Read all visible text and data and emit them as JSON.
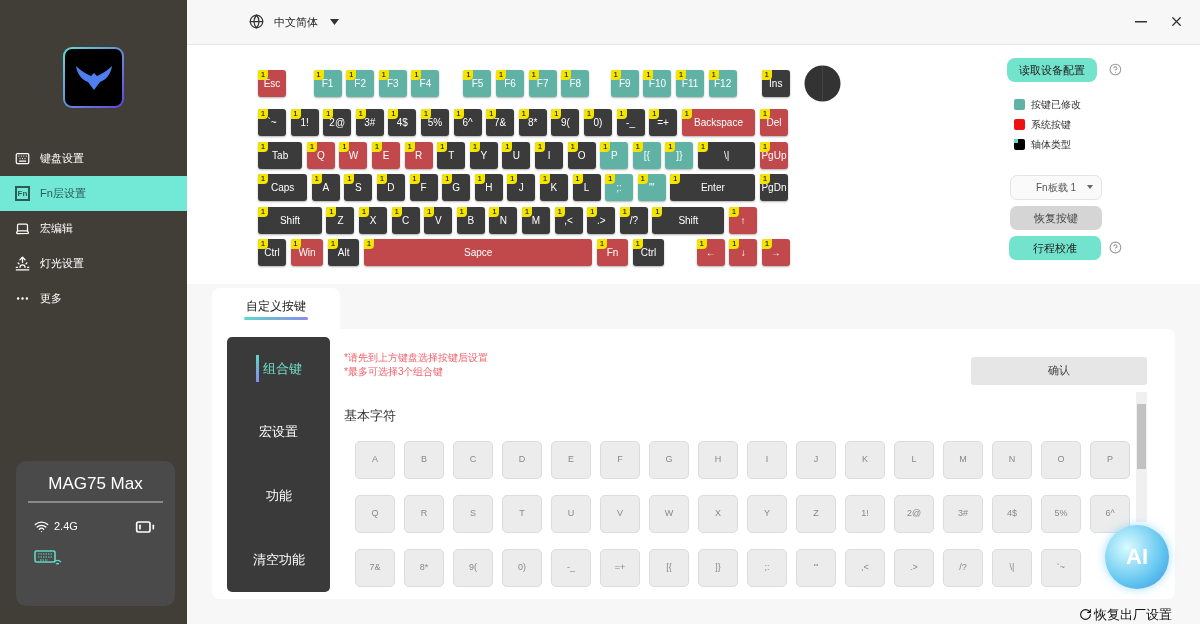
{
  "header": {
    "language": "中文简体"
  },
  "sidebar": {
    "items": [
      {
        "label": "键盘设置",
        "selected": false
      },
      {
        "label": "Fn层设置",
        "icon_text": "Fn",
        "selected": true
      },
      {
        "label": "宏编辑",
        "selected": false
      },
      {
        "label": "灯光设置",
        "selected": false
      },
      {
        "label": "更多",
        "selected": false
      }
    ],
    "device": {
      "name": "MAG75 Max",
      "connection": "2.4G"
    }
  },
  "keyboard": {
    "rows": [
      {
        "keys": [
          {
            "label": "Esc",
            "kind": "system",
            "badge": "1"
          },
          {
            "label": "F1",
            "kind": "modified",
            "badge": "1"
          },
          {
            "label": "F2",
            "kind": "modified",
            "badge": "1"
          },
          {
            "label": "F3",
            "kind": "modified",
            "badge": "1"
          },
          {
            "label": "F4",
            "kind": "modified",
            "badge": "1"
          },
          {
            "label": "F5",
            "kind": "modified",
            "badge": "1"
          },
          {
            "label": "F6",
            "kind": "modified",
            "badge": "1"
          },
          {
            "label": "F7",
            "kind": "modified",
            "badge": "1"
          },
          {
            "label": "F8",
            "kind": "modified",
            "badge": "1"
          },
          {
            "label": "F9",
            "kind": "modified",
            "badge": "1"
          },
          {
            "label": "F10",
            "kind": "modified",
            "badge": "1"
          },
          {
            "label": "F11",
            "kind": "modified",
            "badge": "1"
          },
          {
            "label": "F12",
            "kind": "modified",
            "badge": "1"
          },
          {
            "label": "Ins",
            "kind": "normal",
            "badge": "1"
          }
        ]
      },
      {
        "keys": [
          {
            "label": "`~",
            "kind": "normal",
            "badge": "1"
          },
          {
            "label": "1!",
            "kind": "normal",
            "badge": "1"
          },
          {
            "label": "2@",
            "kind": "normal",
            "badge": "1"
          },
          {
            "label": "3#",
            "kind": "normal",
            "badge": "1"
          },
          {
            "label": "4$",
            "kind": "normal",
            "badge": "1"
          },
          {
            "label": "5%",
            "kind": "normal",
            "badge": "1"
          },
          {
            "label": "6^",
            "kind": "normal",
            "badge": "1"
          },
          {
            "label": "7&",
            "kind": "normal",
            "badge": "1"
          },
          {
            "label": "8*",
            "kind": "normal",
            "badge": "1"
          },
          {
            "label": "9(",
            "kind": "normal",
            "badge": "1"
          },
          {
            "label": "0)",
            "kind": "normal",
            "badge": "1"
          },
          {
            "label": "-_",
            "kind": "normal",
            "badge": "1"
          },
          {
            "label": "=+",
            "kind": "normal",
            "badge": "1"
          },
          {
            "label": "Backspace",
            "kind": "system",
            "badge": "1"
          },
          {
            "label": "Del",
            "kind": "system",
            "badge": "1"
          }
        ]
      },
      {
        "keys": [
          {
            "label": "Tab",
            "kind": "normal",
            "badge": "1"
          },
          {
            "label": "Q",
            "kind": "system",
            "badge": "1"
          },
          {
            "label": "W",
            "kind": "system",
            "badge": "1"
          },
          {
            "label": "E",
            "kind": "system",
            "badge": "1"
          },
          {
            "label": "R",
            "kind": "system",
            "badge": "1"
          },
          {
            "label": "T",
            "kind": "normal",
            "badge": "1"
          },
          {
            "label": "Y",
            "kind": "normal",
            "badge": "1"
          },
          {
            "label": "U",
            "kind": "normal",
            "badge": "1"
          },
          {
            "label": "I",
            "kind": "normal",
            "badge": "1"
          },
          {
            "label": "O",
            "kind": "normal",
            "badge": "1"
          },
          {
            "label": "P",
            "kind": "modified",
            "badge": "1"
          },
          {
            "label": "[{",
            "kind": "modified",
            "badge": "1"
          },
          {
            "label": "]}",
            "kind": "modified",
            "badge": "1"
          },
          {
            "label": "\\|",
            "kind": "normal",
            "badge": "1"
          },
          {
            "label": "PgUp",
            "kind": "system",
            "badge": "1"
          }
        ]
      },
      {
        "keys": [
          {
            "label": "Caps",
            "kind": "normal",
            "badge": "1"
          },
          {
            "label": "A",
            "kind": "normal",
            "badge": "1"
          },
          {
            "label": "S",
            "kind": "normal",
            "badge": "1"
          },
          {
            "label": "D",
            "kind": "normal",
            "badge": "1"
          },
          {
            "label": "F",
            "kind": "normal",
            "badge": "1"
          },
          {
            "label": "G",
            "kind": "normal",
            "badge": "1"
          },
          {
            "label": "H",
            "kind": "normal",
            "badge": "1"
          },
          {
            "label": "J",
            "kind": "normal",
            "badge": "1"
          },
          {
            "label": "K",
            "kind": "normal",
            "badge": "1"
          },
          {
            "label": "L",
            "kind": "normal",
            "badge": "1"
          },
          {
            "label": ";:",
            "kind": "modified",
            "badge": "1"
          },
          {
            "label": "'\"",
            "kind": "modified",
            "badge": "1"
          },
          {
            "label": "Enter",
            "kind": "normal",
            "badge": "1"
          },
          {
            "label": "PgDn",
            "kind": "normal",
            "badge": "1"
          }
        ]
      },
      {
        "keys": [
          {
            "label": "Shift",
            "kind": "normal",
            "badge": "1"
          },
          {
            "label": "Z",
            "kind": "normal",
            "badge": "1"
          },
          {
            "label": "X",
            "kind": "normal",
            "badge": "1"
          },
          {
            "label": "C",
            "kind": "normal",
            "badge": "1"
          },
          {
            "label": "V",
            "kind": "normal",
            "badge": "1"
          },
          {
            "label": "B",
            "kind": "normal",
            "badge": "1"
          },
          {
            "label": "N",
            "kind": "normal",
            "badge": "1"
          },
          {
            "label": "M",
            "kind": "normal",
            "badge": "1"
          },
          {
            "label": ",<",
            "kind": "normal",
            "badge": "1"
          },
          {
            "label": ".>",
            "kind": "normal",
            "badge": "1"
          },
          {
            "label": "/?",
            "kind": "normal",
            "badge": "1"
          },
          {
            "label": "Shift",
            "kind": "normal",
            "badge": "1"
          },
          {
            "label": "↑",
            "kind": "system",
            "badge": "1"
          }
        ]
      },
      {
        "keys": [
          {
            "label": "Ctrl",
            "kind": "normal",
            "badge": "1"
          },
          {
            "label": "Win",
            "kind": "system",
            "badge": "1"
          },
          {
            "label": "Alt",
            "kind": "normal",
            "badge": "1"
          },
          {
            "label": "Sapce",
            "kind": "system",
            "badge": "1"
          },
          {
            "label": "Fn",
            "kind": "system",
            "badge": "1"
          },
          {
            "label": "Ctrl",
            "kind": "normal",
            "badge": "1"
          },
          {
            "label": "←",
            "kind": "system",
            "badge": "1"
          },
          {
            "label": "↓",
            "kind": "system",
            "badge": "1"
          },
          {
            "label": "→",
            "kind": "system",
            "badge": "1"
          }
        ]
      }
    ]
  },
  "side_panel": {
    "read_button": "读取设备配置",
    "legend": [
      {
        "label": "按键已修改",
        "kind": "modified"
      },
      {
        "label": "系统按键",
        "kind": "system"
      },
      {
        "label": "轴体类型",
        "kind": "switch"
      }
    ],
    "layer_select": "Fn板载 1",
    "restore_button": "恢复按键",
    "calibrate_button": "行程校准"
  },
  "tabs": [
    {
      "label": "自定义按键",
      "selected": true
    }
  ],
  "custom_menu": [
    {
      "label": "组合键",
      "selected": true
    },
    {
      "label": "宏设置",
      "selected": false
    },
    {
      "label": "功能",
      "selected": false
    },
    {
      "label": "清空功能",
      "selected": false
    }
  ],
  "hints": [
    "*请先到上方键盘选择按键后设置",
    "*最多可选择3个组合键"
  ],
  "confirm_button": "确认",
  "section_title": "基本字符",
  "char_keys": [
    [
      "A",
      "B",
      "C",
      "D",
      "E",
      "F",
      "G",
      "H",
      "I",
      "J",
      "K",
      "L",
      "M",
      "N",
      "O",
      "P"
    ],
    [
      "Q",
      "R",
      "S",
      "T",
      "U",
      "V",
      "W",
      "X",
      "Y",
      "Z",
      "1!",
      "2@",
      "3#",
      "4$",
      "5%",
      "6^"
    ],
    [
      "7&",
      "8*",
      "9(",
      "0)",
      "-_",
      "=+",
      "[{",
      "]}",
      ";:",
      "'\"",
      ",<",
      ".>",
      "/?",
      "\\|",
      "`~"
    ]
  ],
  "ai_button": "AI",
  "factory_reset": "恢复出厂设置"
}
